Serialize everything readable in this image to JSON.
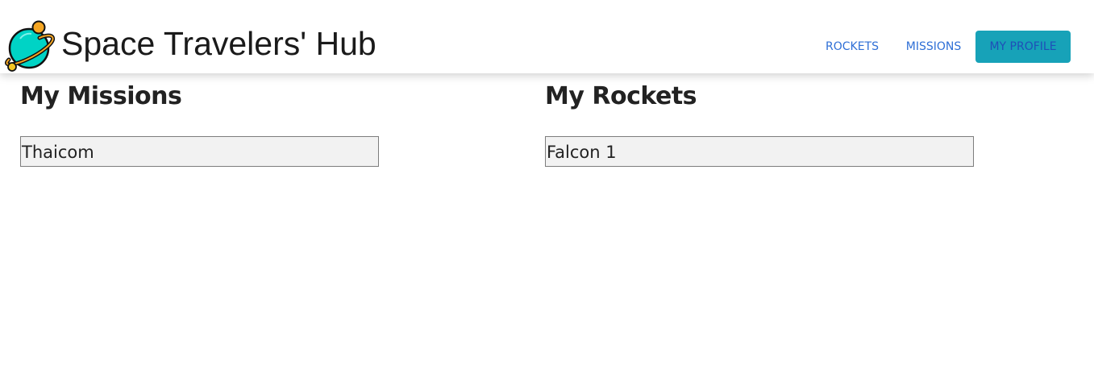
{
  "header": {
    "title": "Space Travelers' Hub",
    "logo_icon": "planet-icon"
  },
  "nav": {
    "items": [
      {
        "label": "ROCKETS",
        "active": false
      },
      {
        "label": "MISSIONS",
        "active": false
      },
      {
        "label": "MY PROFILE",
        "active": true
      }
    ]
  },
  "profile": {
    "missions": {
      "title": "My Missions",
      "items": [
        "Thaicom"
      ]
    },
    "rockets": {
      "title": "My Rockets",
      "items": [
        "Falcon 1"
      ]
    }
  },
  "colors": {
    "accent": "#17a2b8",
    "link": "#2f6fd6",
    "item_background": "#f2f2f2",
    "item_border": "#7d7d7d",
    "logo_planet": "#00d3c5",
    "logo_moon": "#f5a623"
  }
}
